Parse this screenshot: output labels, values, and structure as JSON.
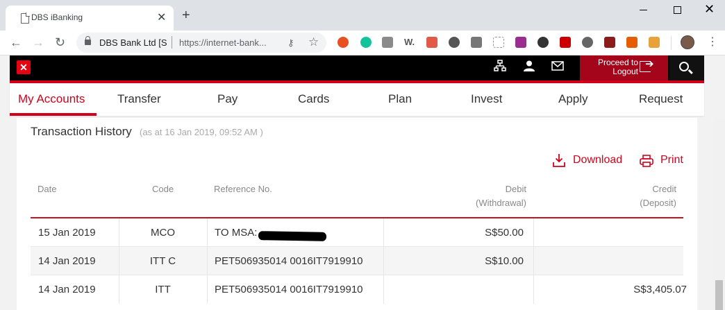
{
  "browser": {
    "tab_title": "DBS iBanking",
    "tab_close": "✕",
    "new_tab": "+",
    "site_name": "DBS Bank Ltd [S",
    "url": "https://internet-bank..."
  },
  "header": {
    "logo": "✕",
    "proceed_line1": "Proceed to",
    "proceed_line2": "Logout"
  },
  "nav": {
    "items": [
      "My Accounts",
      "Transfer",
      "Pay",
      "Cards",
      "Plan",
      "Invest",
      "Apply",
      "Request"
    ],
    "active": "My Accounts"
  },
  "history": {
    "title": "Transaction History",
    "subtitle": "(as at 16 Jan 2019, 09:52 AM )",
    "download_label": "Download",
    "print_label": "Print",
    "columns": {
      "date": "Date",
      "code": "Code",
      "reference": "Reference No.",
      "debit_1": "Debit",
      "debit_2": "(Withdrawal)",
      "credit_1": "Credit",
      "credit_2": "(Deposit)"
    },
    "rows": [
      {
        "date": "15 Jan 2019",
        "code": "MCO",
        "reference": "TO MSA:",
        "debit": "S$50.00",
        "credit": ""
      },
      {
        "date": "14 Jan 2019",
        "code": "ITT C",
        "reference": "PET506935014 0016IT7919910",
        "debit": "S$10.00",
        "credit": ""
      },
      {
        "date": "14 Jan 2019",
        "code": "ITT",
        "reference": "PET506935014 0016IT7919910",
        "debit": "",
        "credit": "S$3,405.07"
      }
    ]
  },
  "colors": {
    "brand_red": "#d0021b",
    "header_black": "#000000",
    "logout_red": "#a4051a"
  }
}
